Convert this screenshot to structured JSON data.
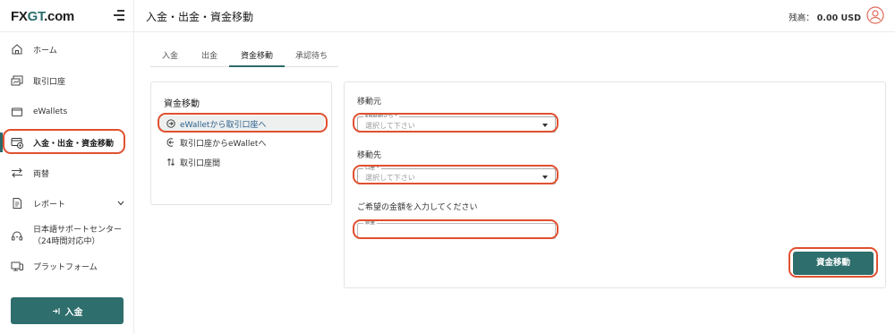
{
  "brand": {
    "logo_text_pre": "FX",
    "logo_text_g": "GT",
    "logo_text_post": ".com",
    "accent": "#2c6b6a",
    "highlight": "#e0502f"
  },
  "header": {
    "title": "入金・出金・資金移動",
    "balance_label": "残高：",
    "balance_amount": "0.00 USD"
  },
  "sidebar": {
    "items": [
      {
        "label": "ホーム",
        "icon": "home-icon"
      },
      {
        "label": "取引口座",
        "icon": "trading-account-icon"
      },
      {
        "label": "eWallets",
        "icon": "wallet-icon"
      },
      {
        "label": "入金・出金・資金移動",
        "icon": "transfer-card-icon"
      },
      {
        "label": "両替",
        "icon": "exchange-icon"
      },
      {
        "label": "レポート",
        "icon": "report-icon"
      },
      {
        "label": "日本語サポートセンター",
        "label2": "（24時間対応中）",
        "icon": "support-headset-icon"
      },
      {
        "label": "プラットフォーム",
        "icon": "platform-icon"
      }
    ],
    "deposit_button": "入金"
  },
  "tabs": [
    {
      "label": "入金"
    },
    {
      "label": "出金"
    },
    {
      "label": "資金移動"
    },
    {
      "label": "承認待ち"
    }
  ],
  "transfer_panel": {
    "title": "資金移動",
    "options": [
      {
        "label": "eWalletから取引口座へ"
      },
      {
        "label": "取引口座からeWalletへ"
      },
      {
        "label": "取引口座間"
      }
    ]
  },
  "form": {
    "from_label": "移動元",
    "from_field_label": "eWalletから *",
    "from_placeholder": "選択して下さい",
    "to_label": "移動先",
    "to_field_label": "口座 *",
    "to_placeholder": "選択して下さい",
    "amount_label": "ご希望の金額を入力してください",
    "amount_field_label": "数量",
    "amount_value": "",
    "submit": "資金移動"
  }
}
